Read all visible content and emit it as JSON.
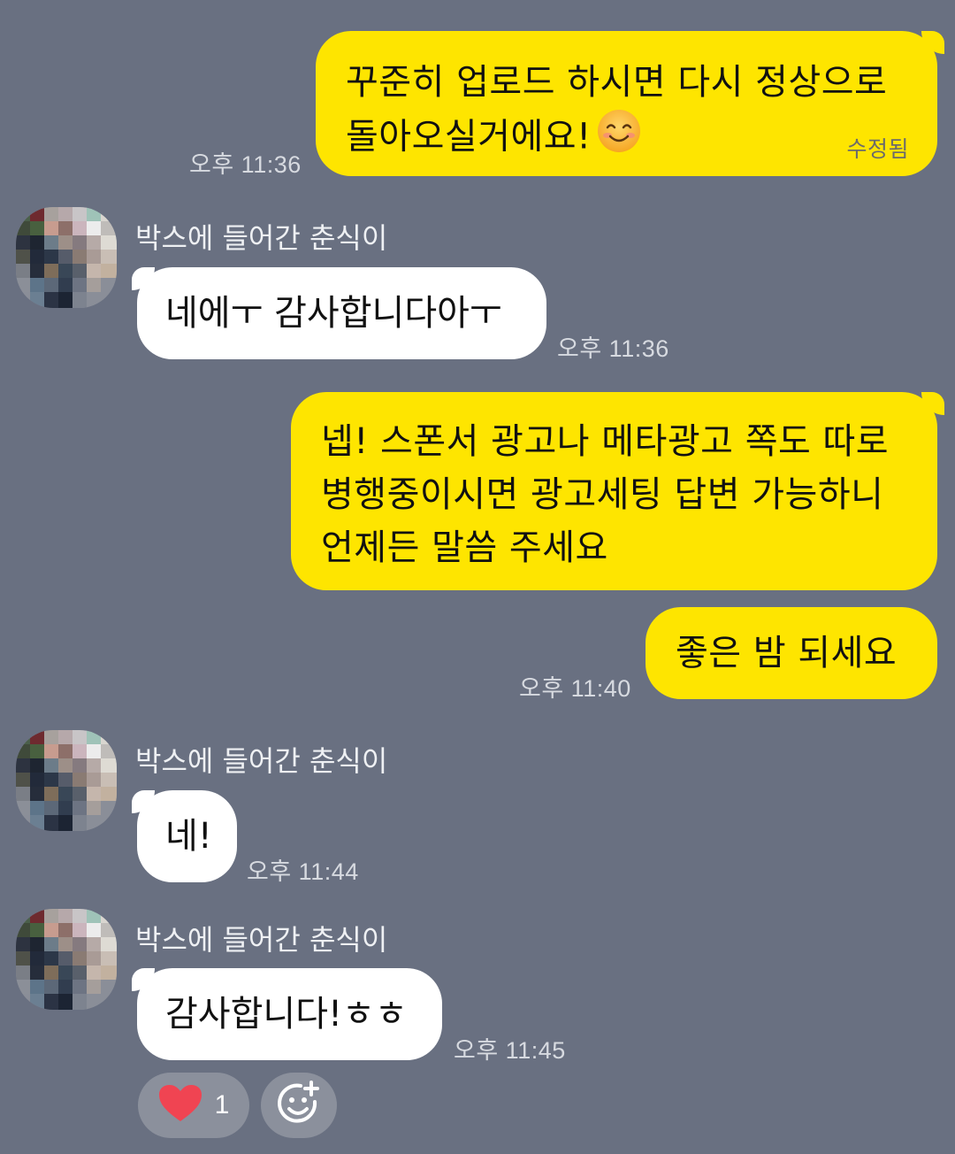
{
  "messages": {
    "m1": {
      "lines": [
        "꾸준히 업로드 하시면 다시 정상으로",
        "돌아오실거에요!"
      ],
      "emoji": "smiling-face",
      "edited": "수정됨",
      "time": "오후 11:36"
    },
    "m2": {
      "sender": "박스에 들어간 춘식이",
      "text": "네에ㅜ 감사합니다아ㅜ",
      "time": "오후 11:36"
    },
    "m3": {
      "lines": [
        "넵! 스폰서 광고나 메타광고 쪽도 따로",
        "병행중이시면 광고세팅 답변 가능하니",
        "언제든 말씀 주세요"
      ]
    },
    "m4": {
      "text": "좋은 밤 되세요",
      "time": "오후 11:40"
    },
    "m5": {
      "sender": "박스에 들어간 춘식이",
      "text": "네!",
      "time": "오후 11:44"
    },
    "m6": {
      "sender": "박스에 들어간 춘식이",
      "text": "감사합니다!ㅎㅎ",
      "time": "오후 11:45"
    }
  },
  "reactions": {
    "heart_count": "1",
    "heart_icon": "heart-icon",
    "add_icon": "add-reaction-icon"
  },
  "colors": {
    "background": "#697081",
    "outgoing": "#fee500",
    "incoming": "#ffffff"
  }
}
